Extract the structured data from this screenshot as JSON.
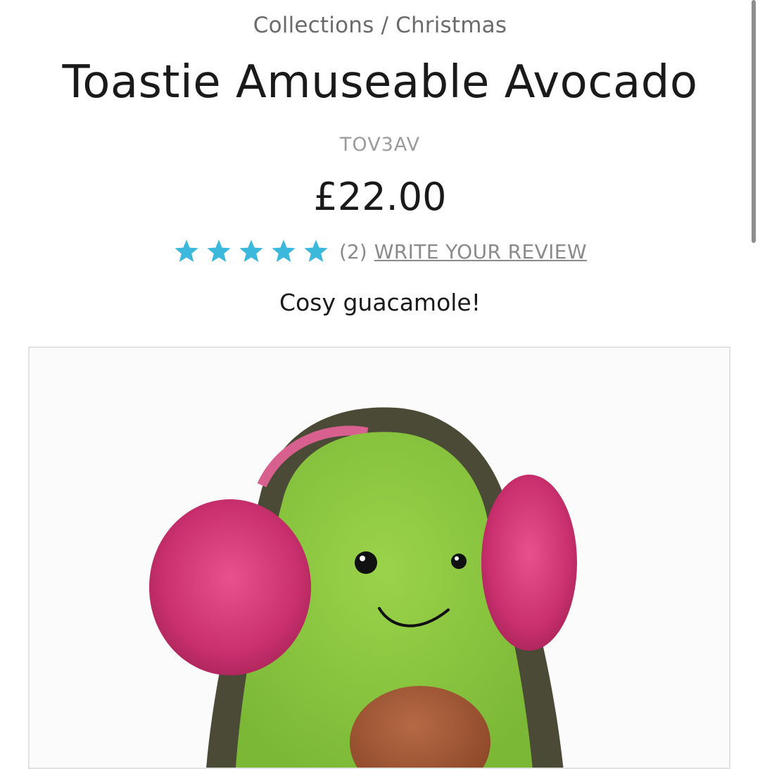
{
  "breadcrumb": {
    "items": [
      "Collections",
      "Christmas"
    ],
    "separator": "/"
  },
  "product": {
    "title": "Toastie Amuseable Avocado",
    "sku": "TOV3AV",
    "price": "£22.00",
    "rating": {
      "stars": 5,
      "max_stars": 5,
      "count_text": "(2)",
      "write_review_label": "WRITE YOUR REVIEW",
      "star_color": "#3bb8db"
    },
    "tagline": "Cosy guacamole!"
  },
  "colors": {
    "avocado_green": "#8cc63f",
    "avocado_skin": "#4a4a34",
    "earmuff_pink": "#d63a7a",
    "pit_brown": "#a0522d"
  }
}
